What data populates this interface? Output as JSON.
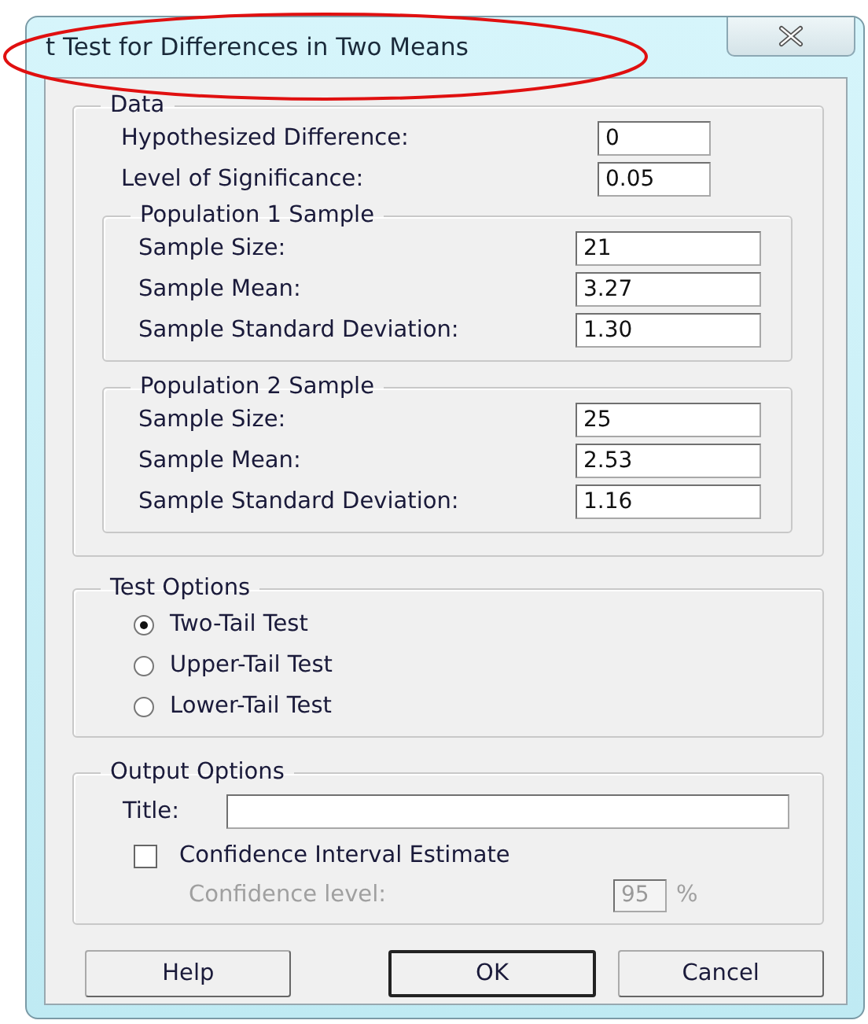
{
  "window": {
    "title": "t Test for Differences in Two Means"
  },
  "data": {
    "legend": "Data",
    "fields": [
      {
        "label": "Hypothesized Difference:",
        "value": "0"
      },
      {
        "label": "Level of Significance:",
        "value": "0.05"
      }
    ],
    "populations": [
      {
        "legend": "Population 1 Sample",
        "fields": [
          {
            "label": "Sample Size:",
            "value": "21"
          },
          {
            "label": "Sample Mean:",
            "value": "3.27"
          },
          {
            "label": "Sample Standard Deviation:",
            "value": "1.30"
          }
        ]
      },
      {
        "legend": "Population 2 Sample",
        "fields": [
          {
            "label": "Sample Size:",
            "value": "25"
          },
          {
            "label": "Sample Mean:",
            "value": "2.53"
          },
          {
            "label": "Sample Standard Deviation:",
            "value": "1.16"
          }
        ]
      }
    ]
  },
  "test_options": {
    "legend": "Test Options",
    "options": [
      {
        "label": "Two-Tail Test",
        "selected": true
      },
      {
        "label": "Upper-Tail Test",
        "selected": false
      },
      {
        "label": "Lower-Tail Test",
        "selected": false
      }
    ]
  },
  "output_options": {
    "legend": "Output Options",
    "title_label": "Title:",
    "confidence_interval": {
      "label": "Confidence Interval Estimate",
      "checked": false
    },
    "confidence_level": {
      "label": "Confidence level:",
      "value": "95",
      "unit": "%",
      "disabled": true
    }
  },
  "buttons": [
    {
      "label": "Help",
      "default": false
    },
    {
      "label": "OK",
      "default": true
    },
    {
      "label": "Cancel",
      "default": false
    }
  ]
}
